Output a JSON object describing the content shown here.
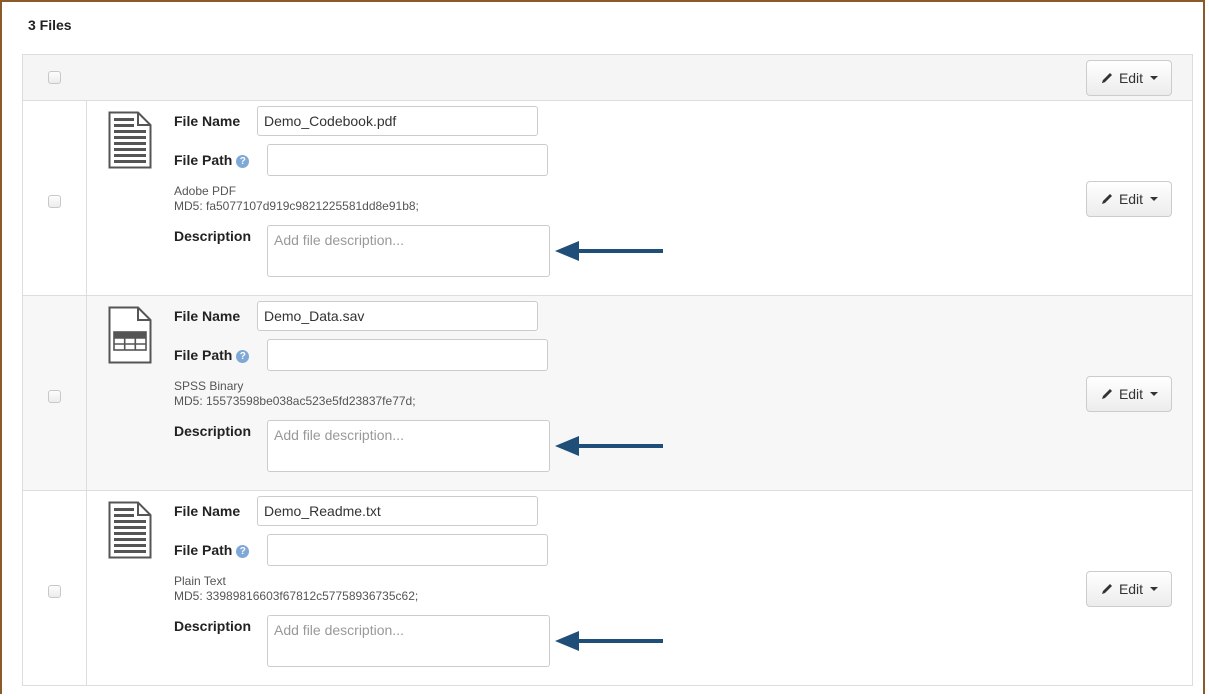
{
  "header": {
    "files_count": "3 Files"
  },
  "labels": {
    "file_name": "File Name",
    "file_path": "File Path",
    "description": "Description",
    "help": "?"
  },
  "edit_button": {
    "label": "Edit"
  },
  "colors": {
    "arrow": "#1f4e79",
    "frame": "#8a5a2b",
    "help": "#7ea8d6"
  },
  "files": [
    {
      "icon": "document-icon",
      "name": "Demo_Codebook.pdf",
      "path": "",
      "type": "Adobe PDF",
      "md5": "MD5: fa5077107d919c9821225581dd8e91b8;",
      "description_placeholder": "Add file description..."
    },
    {
      "icon": "spreadsheet-icon",
      "name": "Demo_Data.sav",
      "path": "",
      "type": "SPSS Binary",
      "md5": "MD5: 15573598be038ac523e5fd23837fe77d;",
      "description_placeholder": "Add file description..."
    },
    {
      "icon": "document-icon",
      "name": "Demo_Readme.txt",
      "path": "",
      "type": "Plain Text",
      "md5": "MD5: 33989816603f67812c57758936735c62;",
      "description_placeholder": "Add file description..."
    }
  ]
}
